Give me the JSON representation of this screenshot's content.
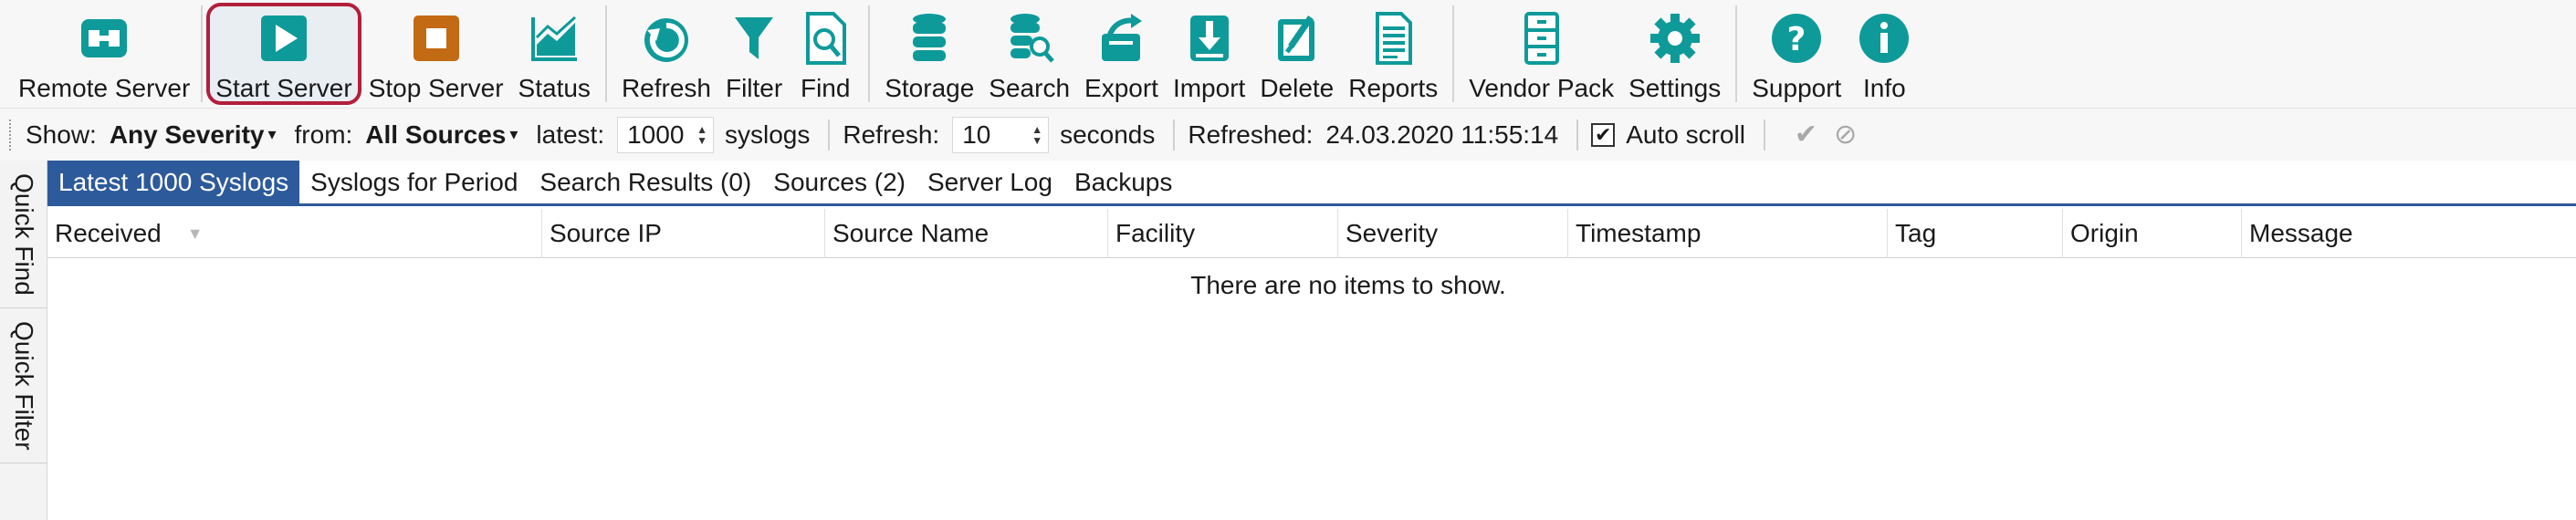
{
  "toolbar": {
    "groups": [
      [
        {
          "name": "remote-server-button",
          "icon": "plug-icon",
          "label": "Remote Server"
        },
        {
          "name": "start-server-button",
          "icon": "play-icon",
          "label": "Start Server",
          "highlighted": true
        },
        {
          "name": "stop-server-button",
          "icon": "stop-icon",
          "label": "Stop Server"
        },
        {
          "name": "status-button",
          "icon": "chart-icon",
          "label": "Status"
        }
      ],
      [
        {
          "name": "refresh-button",
          "icon": "refresh-icon",
          "label": "Refresh"
        },
        {
          "name": "filter-button",
          "icon": "filter-icon",
          "label": "Filter"
        },
        {
          "name": "find-button",
          "icon": "find-document-icon",
          "label": "Find"
        }
      ],
      [
        {
          "name": "storage-button",
          "icon": "database-icon",
          "label": "Storage"
        },
        {
          "name": "search-button",
          "icon": "database-search-icon",
          "label": "Search"
        },
        {
          "name": "export-button",
          "icon": "export-icon",
          "label": "Export"
        },
        {
          "name": "import-button",
          "icon": "import-icon",
          "label": "Import"
        },
        {
          "name": "delete-button",
          "icon": "delete-icon",
          "label": "Delete"
        },
        {
          "name": "reports-button",
          "icon": "reports-icon",
          "label": "Reports"
        }
      ],
      [
        {
          "name": "vendor-pack-button",
          "icon": "cabinet-icon",
          "label": "Vendor Pack"
        },
        {
          "name": "settings-button",
          "icon": "gear-icon",
          "label": "Settings"
        }
      ],
      [
        {
          "name": "support-button",
          "icon": "help-icon",
          "label": "Support"
        },
        {
          "name": "info-button",
          "icon": "info-icon",
          "label": "Info"
        }
      ]
    ]
  },
  "options": {
    "show_label": "Show:",
    "severity_value": "Any Severity",
    "from_label": "from:",
    "sources_value": "All Sources",
    "latest_label": "latest:",
    "latest_value": "1000",
    "syslogs_label": "syslogs",
    "refresh_label": "Refresh:",
    "refresh_value": "10",
    "seconds_label": "seconds",
    "refreshed_label": "Refreshed:",
    "refreshed_value": "24.03.2020 11:55:14",
    "autoscroll_label": "Auto scroll",
    "autoscroll_checked": true
  },
  "side_tabs": [
    "Quick Find",
    "Quick Filter"
  ],
  "tabs": [
    {
      "label": "Latest 1000 Syslogs",
      "active": true
    },
    {
      "label": "Syslogs for Period"
    },
    {
      "label": "Search Results (0)"
    },
    {
      "label": "Sources (2)"
    },
    {
      "label": "Server Log"
    },
    {
      "label": "Backups"
    }
  ],
  "columns": [
    "Received",
    "Source IP",
    "Source Name",
    "Facility",
    "Severity",
    "Timestamp",
    "Tag",
    "Origin",
    "Message"
  ],
  "empty_message": "There are no items to show.",
  "colors": {
    "accent": "#0f9a9a",
    "stop": "#c36a14",
    "highlight_border": "#b21f3a",
    "active_tab": "#2d5a9a"
  }
}
